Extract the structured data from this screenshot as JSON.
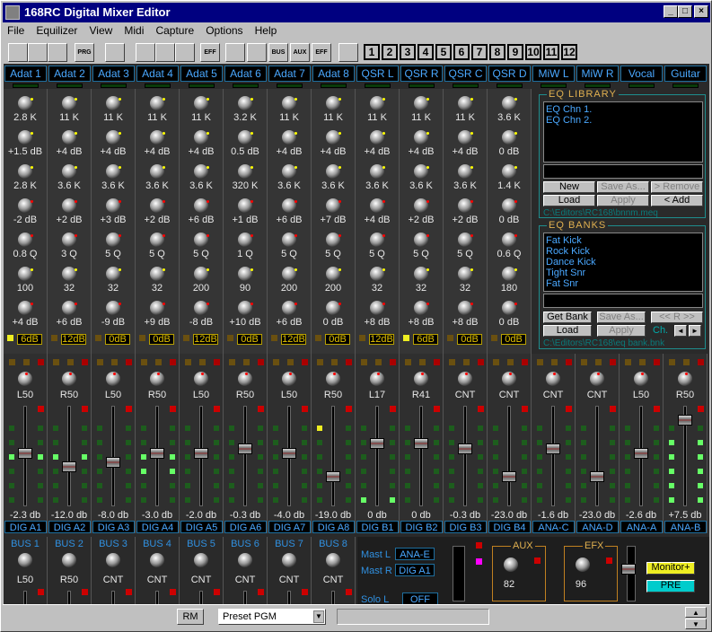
{
  "window": {
    "title": "168RC Digital Mixer Editor",
    "min": "_",
    "max": "□",
    "close": "×"
  },
  "menu": [
    "File",
    "Equilizer",
    "View",
    "Midi",
    "Capture",
    "Options",
    "Help"
  ],
  "toolbar": {
    "b1": "PRG",
    "b2": "EFF",
    "b3": "BUS",
    "b4": "AUX",
    "b5": "EFF",
    "nums": [
      "1",
      "2",
      "3",
      "4",
      "5",
      "6",
      "7",
      "8",
      "9",
      "10",
      "11",
      "12"
    ]
  },
  "channels": [
    "Adat 1",
    "Adat 2",
    "Adat 3",
    "Adat 4",
    "Adat 5",
    "Adat 6",
    "Adat 7",
    "Adat 8",
    "QSR L",
    "QSR R",
    "QSR C",
    "QSR D",
    "MiW L",
    "MiW R",
    "Vocal",
    "Guitar"
  ],
  "eq": [
    [
      "2.8 K",
      "+1.5 dB",
      "2.8 K",
      "-2 dB",
      "0.8 Q",
      "100",
      "+4 dB",
      "6dB"
    ],
    [
      "11 K",
      "+4 dB",
      "3.6 K",
      "+2 dB",
      "3 Q",
      "32",
      "+6 dB",
      "12dB"
    ],
    [
      "11 K",
      "+4 dB",
      "3.6 K",
      "+3 dB",
      "5 Q",
      "32",
      "-9 dB",
      "0dB"
    ],
    [
      "11 K",
      "+4 dB",
      "3.6 K",
      "+2 dB",
      "5 Q",
      "32",
      "+9 dB",
      "0dB"
    ],
    [
      "11 K",
      "+4 dB",
      "3.6 K",
      "+6 dB",
      "5 Q",
      "200",
      "-8 dB",
      "12dB"
    ],
    [
      "3.2 K",
      "0.5 dB",
      "320 K",
      "+1 dB",
      "1 Q",
      "90",
      "+10 dB",
      "0dB"
    ],
    [
      "11 K",
      "+4 dB",
      "3.6 K",
      "+6 dB",
      "5 Q",
      "200",
      "+6 dB",
      "12dB"
    ],
    [
      "11 K",
      "+4 dB",
      "3.6 K",
      "+7 dB",
      "5 Q",
      "200",
      "0 dB",
      "0dB"
    ],
    [
      "11 K",
      "+4 dB",
      "3.6 K",
      "+4 dB",
      "5 Q",
      "32",
      "+8 dB",
      "12dB"
    ],
    [
      "11 K",
      "+4 dB",
      "3.6 K",
      "+2 dB",
      "5 Q",
      "32",
      "+8 dB",
      "6dB"
    ],
    [
      "11 K",
      "+4 dB",
      "3.6 K",
      "+2 dB",
      "5 Q",
      "32",
      "+8 dB",
      "0dB"
    ],
    [
      "3.6 K",
      "0 dB",
      "1.4 K",
      "0 dB",
      "0.6 Q",
      "180",
      "0 dB",
      "0dB"
    ]
  ],
  "pan": [
    "L50",
    "R50",
    "L50",
    "R50",
    "L50",
    "R50",
    "L50",
    "R50",
    "L17",
    "R41",
    "CNT",
    "CNT",
    "CNT",
    "CNT",
    "L50",
    "R50"
  ],
  "faderdb": [
    "-2.3 db",
    "-12.0 db",
    "-8.0 db",
    "-3.0 db",
    "-2.0 db",
    "-0.3 db",
    "-4.0 db",
    "-19.0 db",
    "0 db",
    "0 db",
    "-0.3 db",
    "-23.0 db",
    "-1.6 db",
    "-23.0 db",
    "-2.6 db",
    "+7.5 db"
  ],
  "faderlevel": [
    0.55,
    0.4,
    0.45,
    0.55,
    0.55,
    0.6,
    0.55,
    0.3,
    0.65,
    0.65,
    0.6,
    0.3,
    0.6,
    0.3,
    0.55,
    0.9
  ],
  "outs": [
    "DIG A1",
    "DIG A2",
    "DIG A3",
    "DIG A4",
    "DIG A5",
    "DIG A6",
    "DIG A7",
    "DIG A8",
    "DIG B1",
    "DIG B2",
    "DIG B3",
    "DIG B4",
    "ANA-C",
    "ANA-D",
    "ANA-A",
    "ANA-B"
  ],
  "buses": [
    [
      "BUS 1",
      "L50"
    ],
    [
      "BUS 2",
      "R50"
    ],
    [
      "BUS 3",
      "CNT"
    ],
    [
      "BUS 4",
      "CNT"
    ],
    [
      "BUS 5",
      "CNT"
    ],
    [
      "BUS 6",
      "CNT"
    ],
    [
      "BUS 7",
      "CNT"
    ],
    [
      "BUS 8",
      "CNT"
    ]
  ],
  "eqlib": {
    "title": "EQ LIBRARY",
    "items": [
      "EQ Chn 1.",
      "EQ Chn 2."
    ],
    "new": "New",
    "saveas": "Save As...",
    "remove": "> Remove",
    "load": "Load",
    "apply": "Apply",
    "add": "< Add",
    "path": "C:\\Editors\\RC168\\bnnm.meq"
  },
  "eqbanks": {
    "title": "EQ BANKS",
    "items": [
      "Fat Kick",
      "Rock Kick",
      "Dance Kick",
      "Tight Snr",
      "Fat Snr"
    ],
    "getbank": "Get Bank",
    "saveas": "Save As...",
    "rr": "<< R >>",
    "load": "Load",
    "apply": "Apply",
    "ch": "Ch.",
    "path": "C:\\Editors\\RC168\\eq bank.bnk"
  },
  "master": {
    "mastl": "Mast L",
    "mastr": "Mast R",
    "mastl_v": "ANA-E",
    "mastr_v": "DIG A1",
    "solo": "Solo L",
    "solo_v": "OFF",
    "aux": "AUX",
    "aux_v": "82",
    "efx": "EFX",
    "efx_v": "96",
    "monitor": "Monitor+",
    "pre": "PRE"
  },
  "status": {
    "rm": "RM",
    "preset": "Preset PGM"
  }
}
